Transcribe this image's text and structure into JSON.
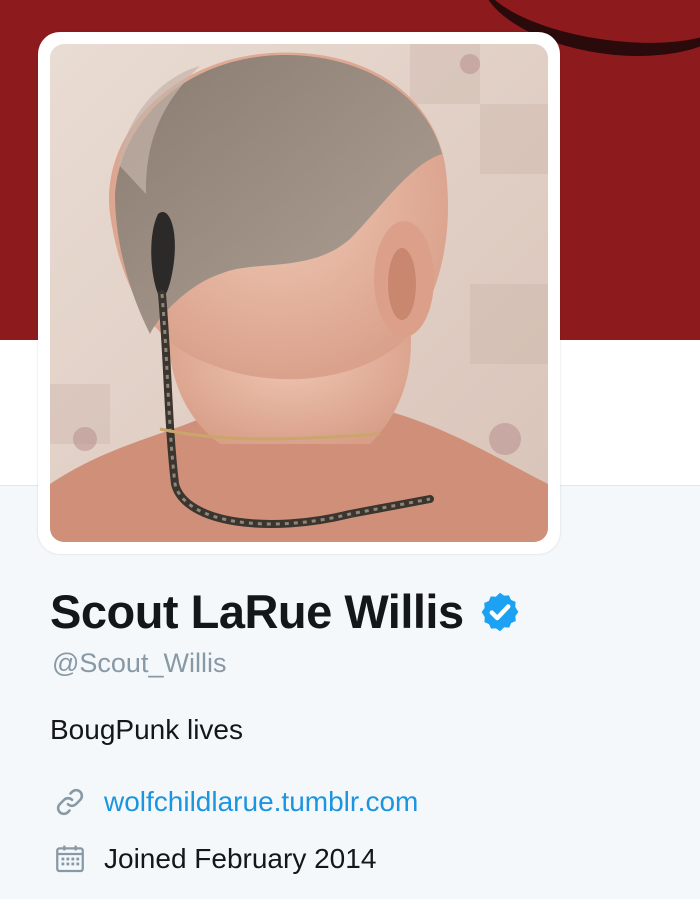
{
  "colors": {
    "banner": "#8d1b1e",
    "link": "#1b95e0",
    "verified": "#1da1f2",
    "text": "#14171a",
    "muted": "#8899a6"
  },
  "profile": {
    "avatar_alt": "profile photo",
    "display_name": "Scout LaRue Willis",
    "verified_icon": "verified-badge-icon",
    "handle": "@Scout_Willis",
    "bio": "BougPunk lives",
    "website": {
      "icon": "link-icon",
      "label": "wolfchildlarue.tumblr.com"
    },
    "joined": {
      "icon": "calendar-icon",
      "label": "Joined February 2014"
    }
  }
}
